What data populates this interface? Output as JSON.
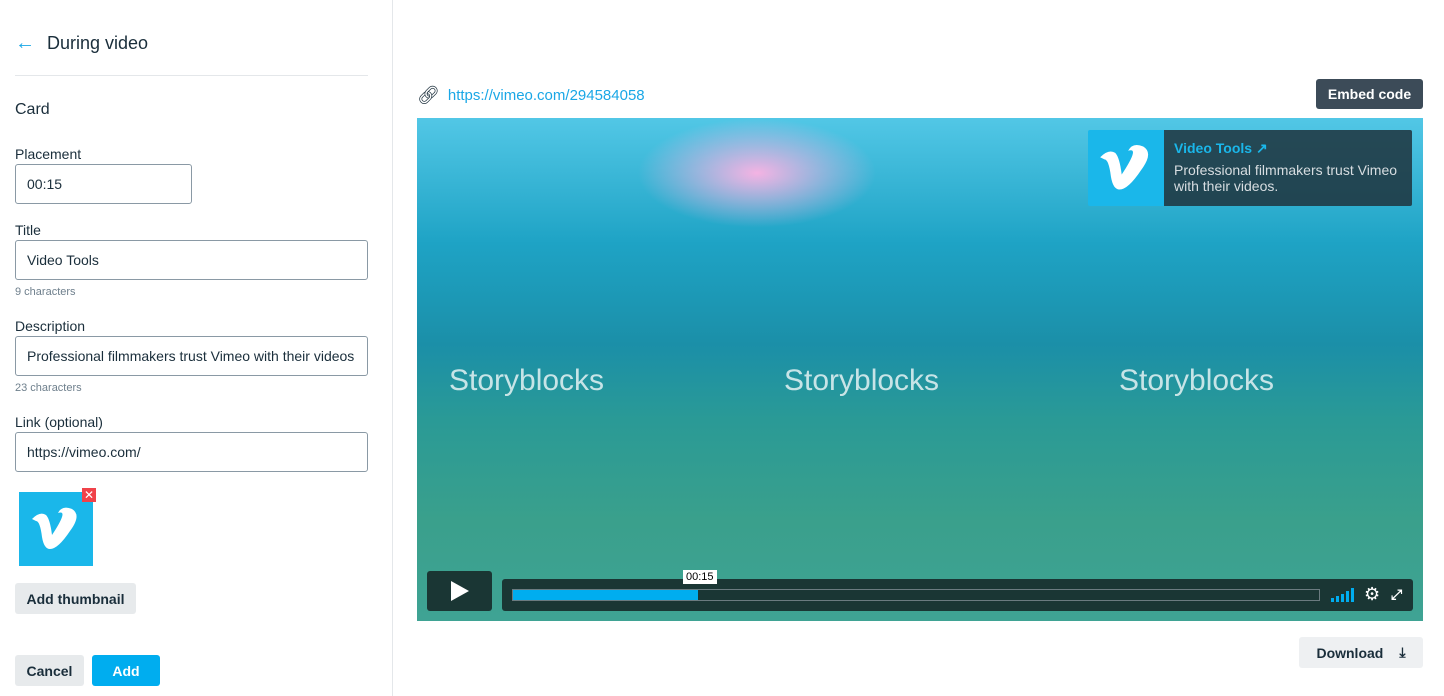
{
  "sidebar": {
    "title": "During video",
    "section": "Card",
    "placement": {
      "label": "Placement",
      "value": "00:15"
    },
    "title_field": {
      "label": "Title",
      "value": "Video Tools",
      "count": "9 characters"
    },
    "description": {
      "label": "Description",
      "value": "Professional filmmakers trust Vimeo with their videos",
      "count": "23 characters"
    },
    "link": {
      "label": "Link (optional)",
      "value": "https://vimeo.com/"
    },
    "add_thumbnail": "Add thumbnail",
    "cancel": "Cancel",
    "add": "Add"
  },
  "main": {
    "url": "https://vimeo.com/294584058",
    "embed": "Embed code",
    "download": "Download",
    "watermarks": [
      "Storyblocks",
      "Storyblocks",
      "Storyblocks"
    ],
    "card": {
      "title": "Video Tools",
      "text": "Professional filmmakers trust Vimeo with their videos."
    },
    "player": {
      "time": "00:15",
      "progress_percent": 23
    }
  },
  "colors": {
    "accent": "#00adef",
    "vimeo": "#1ab7ea"
  }
}
